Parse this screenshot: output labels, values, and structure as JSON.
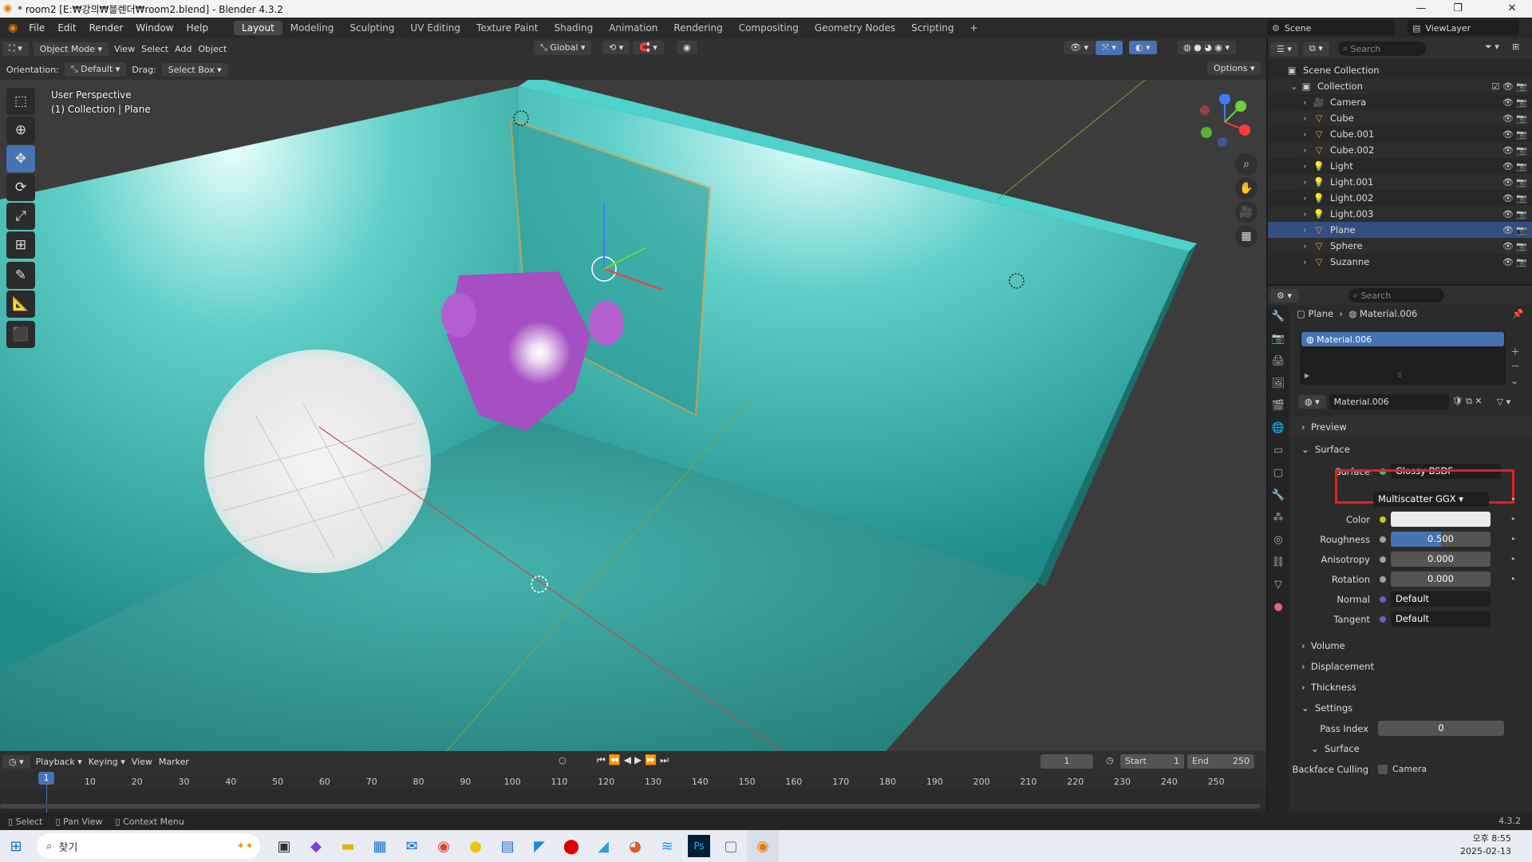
{
  "window": {
    "title": "* room2 [E:₩강의₩블렌더₩room2.blend] - Blender 4.3.2"
  },
  "menus": [
    "File",
    "Edit",
    "Render",
    "Window",
    "Help"
  ],
  "workspaces": [
    "Layout",
    "Modeling",
    "Sculpting",
    "UV Editing",
    "Texture Paint",
    "Shading",
    "Animation",
    "Rendering",
    "Compositing",
    "Geometry Nodes",
    "Scripting"
  ],
  "active_workspace": "Layout",
  "scene": {
    "name": "Scene",
    "view_layer": "ViewLayer"
  },
  "header3d": {
    "mode": "Object Mode",
    "items": [
      "View",
      "Select",
      "Add",
      "Object"
    ],
    "transform": "Global"
  },
  "header3d_row2": {
    "orientation_label": "Orientation:",
    "orientation": "Default",
    "drag_label": "Drag:",
    "drag": "Select Box",
    "options": "Options"
  },
  "viewport": {
    "line1": "User Perspective",
    "line2": "(1) Collection | Plane"
  },
  "outliner": {
    "search_placeholder": "Search",
    "scene_collection": "Scene Collection",
    "collection": "Collection",
    "items": [
      {
        "name": "Camera",
        "type": "camera"
      },
      {
        "name": "Cube",
        "type": "mesh"
      },
      {
        "name": "Cube.001",
        "type": "mesh"
      },
      {
        "name": "Cube.002",
        "type": "mesh"
      },
      {
        "name": "Light",
        "type": "light"
      },
      {
        "name": "Light.001",
        "type": "light"
      },
      {
        "name": "Light.002",
        "type": "light"
      },
      {
        "name": "Light.003",
        "type": "light"
      },
      {
        "name": "Plane",
        "type": "mesh",
        "selected": true
      },
      {
        "name": "Sphere",
        "type": "mesh"
      },
      {
        "name": "Suzanne",
        "type": "mesh"
      }
    ]
  },
  "properties": {
    "search_placeholder": "Search",
    "breadcrumb_object": "Plane",
    "breadcrumb_material": "Material.006",
    "slot": "Material.006",
    "material_name": "Material.006",
    "sections": {
      "preview": "Preview",
      "surface": "Surface",
      "volume": "Volume",
      "displacement": "Displacement",
      "thickness": "Thickness",
      "settings": "Settings",
      "surface_sub": "Surface"
    },
    "surface_label": "Surface",
    "surface_value": "Glossy BSDF",
    "distribution": "Multiscatter GGX",
    "fields": [
      {
        "label": "Color",
        "value": ""
      },
      {
        "label": "Roughness",
        "value": "0.500",
        "fraction": 0.5
      },
      {
        "label": "Anisotropy",
        "value": "0.000"
      },
      {
        "label": "Rotation",
        "value": "0.000"
      },
      {
        "label": "Normal",
        "value": "Default"
      },
      {
        "label": "Tangent",
        "value": "Default"
      }
    ],
    "pass_index_label": "Pass Index",
    "pass_index": "0",
    "backface_label": "Backface Culling",
    "backface_option": "Camera"
  },
  "timeline": {
    "menus": [
      "Playback",
      "Keying",
      "View",
      "Marker"
    ],
    "current_frame": "1",
    "start_label": "Start",
    "start": "1",
    "end_label": "End",
    "end": "250",
    "ticks": [
      "1",
      "10",
      "20",
      "30",
      "40",
      "50",
      "60",
      "70",
      "80",
      "90",
      "100",
      "110",
      "120",
      "130",
      "140",
      "150",
      "160",
      "170",
      "180",
      "190",
      "200",
      "210",
      "220",
      "230",
      "240",
      "250"
    ]
  },
  "statusbar": {
    "select": "Select",
    "pan": "Pan View",
    "context": "Context Menu",
    "version": "4.3.2"
  },
  "taskbar": {
    "search": "찾기",
    "time": "오후 8:55",
    "date": "2025-02-13"
  }
}
